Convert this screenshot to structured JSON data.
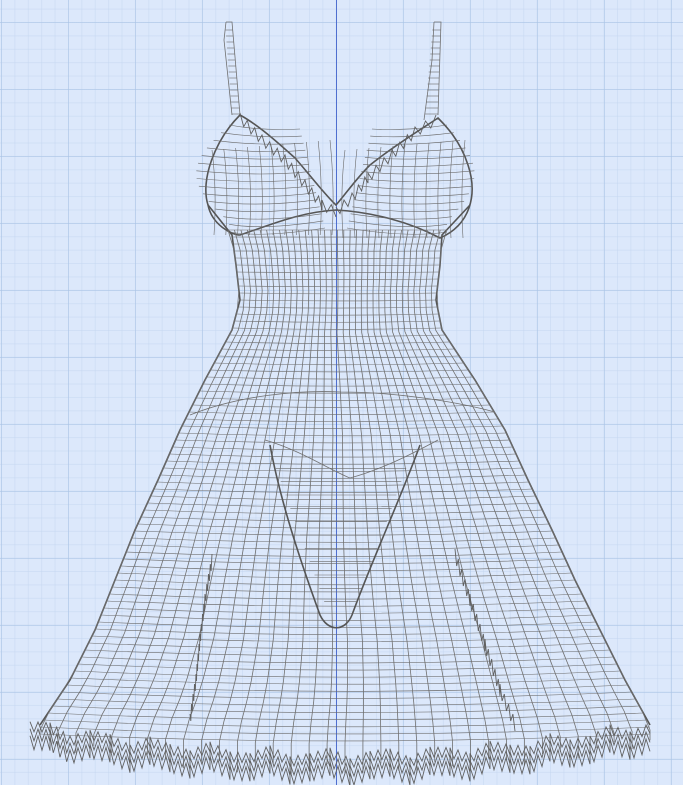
{
  "viewport": {
    "background": "#dce8fb",
    "grid_color": "#aac4e6",
    "axis_color": "#4f6fd0",
    "wire_color": "#707070",
    "object": "dress-wireframe-mesh"
  }
}
